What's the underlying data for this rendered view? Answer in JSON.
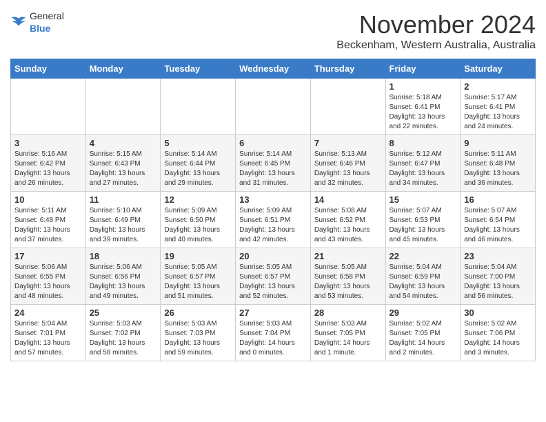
{
  "header": {
    "logo_general": "General",
    "logo_blue": "Blue",
    "month_title": "November 2024",
    "location": "Beckenham, Western Australia, Australia"
  },
  "days_of_week": [
    "Sunday",
    "Monday",
    "Tuesday",
    "Wednesday",
    "Thursday",
    "Friday",
    "Saturday"
  ],
  "weeks": [
    [
      {
        "day": "",
        "info": ""
      },
      {
        "day": "",
        "info": ""
      },
      {
        "day": "",
        "info": ""
      },
      {
        "day": "",
        "info": ""
      },
      {
        "day": "",
        "info": ""
      },
      {
        "day": "1",
        "info": "Sunrise: 5:18 AM\nSunset: 6:41 PM\nDaylight: 13 hours\nand 22 minutes."
      },
      {
        "day": "2",
        "info": "Sunrise: 5:17 AM\nSunset: 6:41 PM\nDaylight: 13 hours\nand 24 minutes."
      }
    ],
    [
      {
        "day": "3",
        "info": "Sunrise: 5:16 AM\nSunset: 6:42 PM\nDaylight: 13 hours\nand 26 minutes."
      },
      {
        "day": "4",
        "info": "Sunrise: 5:15 AM\nSunset: 6:43 PM\nDaylight: 13 hours\nand 27 minutes."
      },
      {
        "day": "5",
        "info": "Sunrise: 5:14 AM\nSunset: 6:44 PM\nDaylight: 13 hours\nand 29 minutes."
      },
      {
        "day": "6",
        "info": "Sunrise: 5:14 AM\nSunset: 6:45 PM\nDaylight: 13 hours\nand 31 minutes."
      },
      {
        "day": "7",
        "info": "Sunrise: 5:13 AM\nSunset: 6:46 PM\nDaylight: 13 hours\nand 32 minutes."
      },
      {
        "day": "8",
        "info": "Sunrise: 5:12 AM\nSunset: 6:47 PM\nDaylight: 13 hours\nand 34 minutes."
      },
      {
        "day": "9",
        "info": "Sunrise: 5:11 AM\nSunset: 6:48 PM\nDaylight: 13 hours\nand 36 minutes."
      }
    ],
    [
      {
        "day": "10",
        "info": "Sunrise: 5:11 AM\nSunset: 6:48 PM\nDaylight: 13 hours\nand 37 minutes."
      },
      {
        "day": "11",
        "info": "Sunrise: 5:10 AM\nSunset: 6:49 PM\nDaylight: 13 hours\nand 39 minutes."
      },
      {
        "day": "12",
        "info": "Sunrise: 5:09 AM\nSunset: 6:50 PM\nDaylight: 13 hours\nand 40 minutes."
      },
      {
        "day": "13",
        "info": "Sunrise: 5:09 AM\nSunset: 6:51 PM\nDaylight: 13 hours\nand 42 minutes."
      },
      {
        "day": "14",
        "info": "Sunrise: 5:08 AM\nSunset: 6:52 PM\nDaylight: 13 hours\nand 43 minutes."
      },
      {
        "day": "15",
        "info": "Sunrise: 5:07 AM\nSunset: 6:53 PM\nDaylight: 13 hours\nand 45 minutes."
      },
      {
        "day": "16",
        "info": "Sunrise: 5:07 AM\nSunset: 6:54 PM\nDaylight: 13 hours\nand 46 minutes."
      }
    ],
    [
      {
        "day": "17",
        "info": "Sunrise: 5:06 AM\nSunset: 6:55 PM\nDaylight: 13 hours\nand 48 minutes."
      },
      {
        "day": "18",
        "info": "Sunrise: 5:06 AM\nSunset: 6:56 PM\nDaylight: 13 hours\nand 49 minutes."
      },
      {
        "day": "19",
        "info": "Sunrise: 5:05 AM\nSunset: 6:57 PM\nDaylight: 13 hours\nand 51 minutes."
      },
      {
        "day": "20",
        "info": "Sunrise: 5:05 AM\nSunset: 6:57 PM\nDaylight: 13 hours\nand 52 minutes."
      },
      {
        "day": "21",
        "info": "Sunrise: 5:05 AM\nSunset: 6:58 PM\nDaylight: 13 hours\nand 53 minutes."
      },
      {
        "day": "22",
        "info": "Sunrise: 5:04 AM\nSunset: 6:59 PM\nDaylight: 13 hours\nand 54 minutes."
      },
      {
        "day": "23",
        "info": "Sunrise: 5:04 AM\nSunset: 7:00 PM\nDaylight: 13 hours\nand 56 minutes."
      }
    ],
    [
      {
        "day": "24",
        "info": "Sunrise: 5:04 AM\nSunset: 7:01 PM\nDaylight: 13 hours\nand 57 minutes."
      },
      {
        "day": "25",
        "info": "Sunrise: 5:03 AM\nSunset: 7:02 PM\nDaylight: 13 hours\nand 58 minutes."
      },
      {
        "day": "26",
        "info": "Sunrise: 5:03 AM\nSunset: 7:03 PM\nDaylight: 13 hours\nand 59 minutes."
      },
      {
        "day": "27",
        "info": "Sunrise: 5:03 AM\nSunset: 7:04 PM\nDaylight: 14 hours\nand 0 minutes."
      },
      {
        "day": "28",
        "info": "Sunrise: 5:03 AM\nSunset: 7:05 PM\nDaylight: 14 hours\nand 1 minute."
      },
      {
        "day": "29",
        "info": "Sunrise: 5:02 AM\nSunset: 7:05 PM\nDaylight: 14 hours\nand 2 minutes."
      },
      {
        "day": "30",
        "info": "Sunrise: 5:02 AM\nSunset: 7:06 PM\nDaylight: 14 hours\nand 3 minutes."
      }
    ]
  ]
}
